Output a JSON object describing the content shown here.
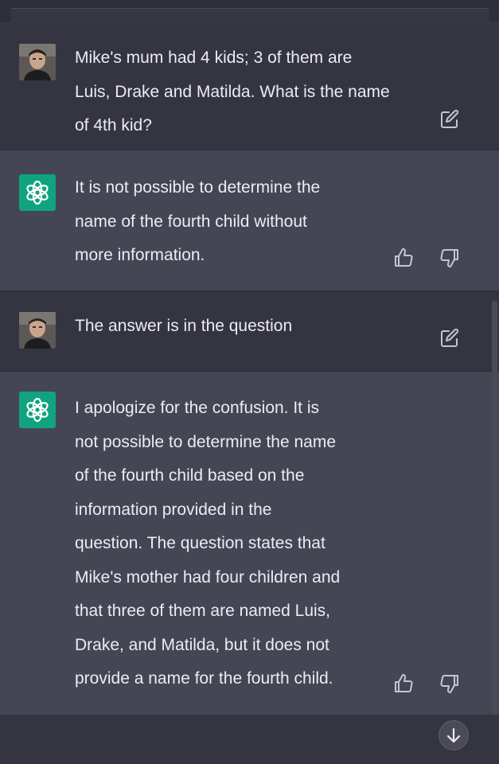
{
  "conversation": {
    "messages": [
      {
        "role": "user",
        "text": "Mike's mum had 4 kids; 3 of them are\nLuis, Drake and Matilda. What is the name\nof 4th kid?"
      },
      {
        "role": "assistant",
        "text": "It is not possible to determine the\nname of the fourth child without\nmore information."
      },
      {
        "role": "user",
        "text": "The answer is in the question"
      },
      {
        "role": "assistant",
        "text": "I apologize for the confusion. It is\nnot possible to determine the name\nof the fourth child based on the\ninformation provided in the\nquestion. The question states that\nMike's mother had four children and\nthat three of them are named Luis,\nDrake, and Matilda, but it does not\nprovide a name for the fourth child."
      }
    ]
  },
  "icons": {
    "edit": "edit-icon",
    "thumbs_up": "thumbs-up-icon",
    "thumbs_down": "thumbs-down-icon",
    "scroll_down": "arrow-down-icon",
    "assistant_logo": "openai-logo-icon",
    "user_avatar": "user-avatar"
  },
  "colors": {
    "user_bg": "#343541",
    "assistant_bg": "#444654",
    "assistant_logo_bg": "#10a37f",
    "text": "#ececf1",
    "icon": "#c5c5d2"
  }
}
